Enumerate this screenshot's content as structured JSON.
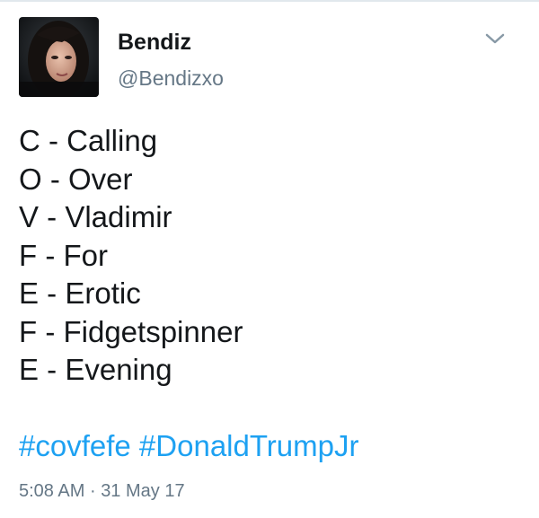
{
  "header": {
    "display_name": "Bendiz",
    "handle": "@Bendizxo",
    "avatar_icon": "user-avatar-photo",
    "menu_icon": "chevron-down-icon"
  },
  "tweet": {
    "lines": [
      "C - Calling",
      "O - Over",
      "V - Vladimir",
      "F - For",
      "E - Erotic",
      "F - Fidgetspinner",
      "E - Evening"
    ],
    "hashtags": [
      "#covfefe",
      "#DonaldTrumpJr"
    ],
    "time": "5:08 AM",
    "separator": "·",
    "date": "31 May 17"
  },
  "colors": {
    "hashtag": "#1da1f2",
    "text": "#14171a",
    "secondary": "#657786"
  }
}
